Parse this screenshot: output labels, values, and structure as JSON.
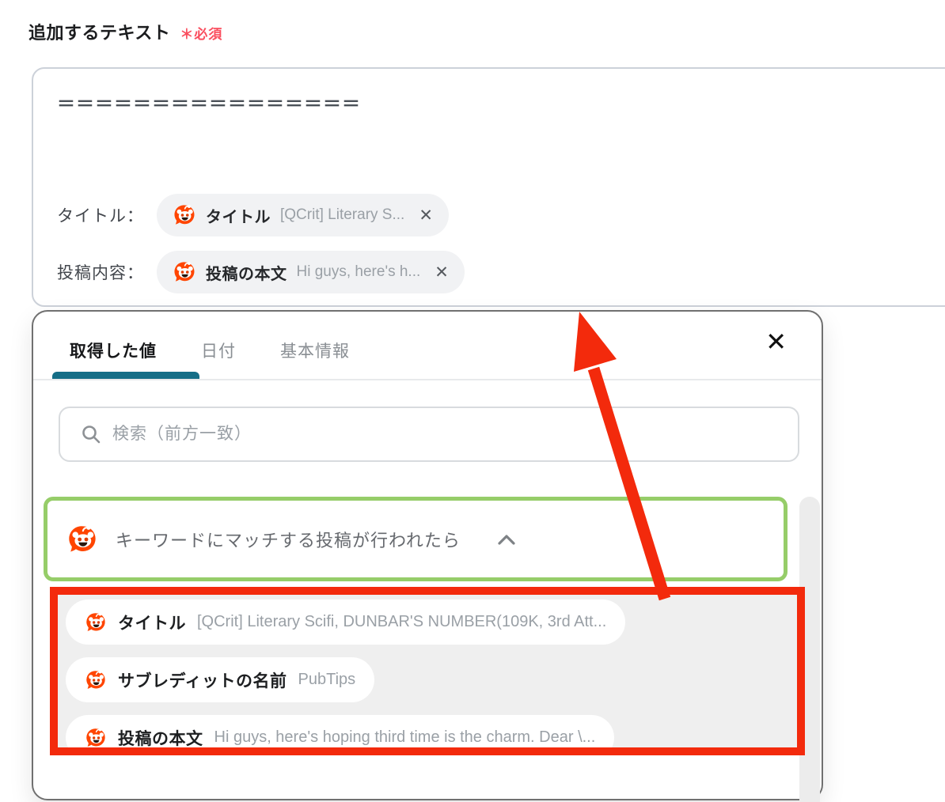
{
  "field": {
    "label": "追加するテキスト",
    "required": "＊必須",
    "text_line": "＝＝＝＝＝＝＝＝＝＝＝＝＝＝＝＝",
    "rows": [
      {
        "label": "タイトル：",
        "token": {
          "name": "タイトル",
          "preview": "[QCrit] Literary S...",
          "close_glyph": "✕"
        }
      },
      {
        "label": "投稿内容：",
        "token": {
          "name": "投稿の本文",
          "preview": "Hi guys, here's h...",
          "close_glyph": "✕"
        }
      }
    ]
  },
  "panel": {
    "tabs": [
      {
        "label": "取得した値",
        "active": true
      },
      {
        "label": "日付",
        "active": false
      },
      {
        "label": "基本情報",
        "active": false
      }
    ],
    "close_glyph": "✕",
    "search": {
      "placeholder": "検索（前方一致）",
      "value": ""
    },
    "trigger": {
      "label": "キーワードにマッチする投稿が行われたら"
    },
    "items": [
      {
        "name": "タイトル",
        "preview": "[QCrit] Literary Scifi, DUNBAR'S NUMBER(109K, 3rd Att..."
      },
      {
        "name": "サブレディットの名前",
        "preview": "PubTips"
      },
      {
        "name": "投稿の本文",
        "preview": "Hi guys, here's hoping third time is the charm. Dear \\..."
      }
    ]
  },
  "colors": {
    "annotation_red": "#f32a0c",
    "trigger_green_border": "#96cd69",
    "active_tab_teal": "#156e87",
    "required_red": "#fa4e5e",
    "reddit_orange": "#ff4500"
  }
}
